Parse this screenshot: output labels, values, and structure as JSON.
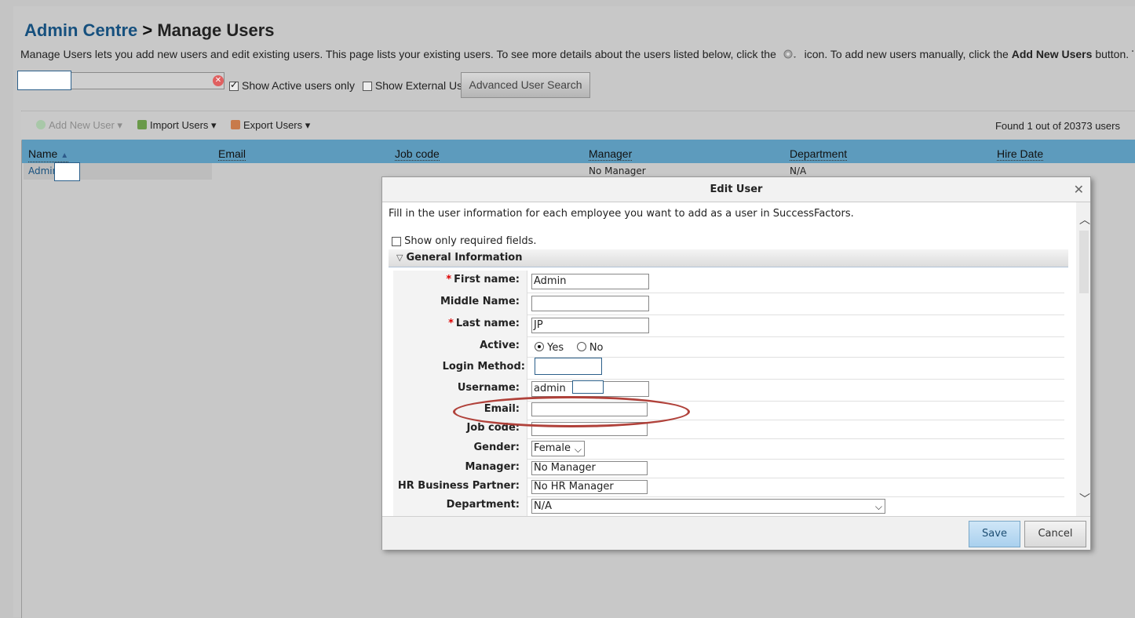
{
  "breadcrumb": {
    "parent": "Admin Centre",
    "separator": ">",
    "current": "Manage Users"
  },
  "description": {
    "before_icon": "Manage Users lets you add new users and edit existing users. This page lists your existing users. To see more details about the users listed below, click the",
    "after_icon": "icon. To add new users manually, click the",
    "bold": "Add New Users",
    "tail": "button. To import your use"
  },
  "filters": {
    "show_active_label": "Show Active users only",
    "show_active_checked": true,
    "show_external_label": "Show External User",
    "show_external_checked": false,
    "advanced_search_label": "Advanced User Search"
  },
  "toolbar": {
    "add_new_user": "Add New User",
    "import_users": "Import Users",
    "export_users": "Export Users",
    "found_text": "Found 1 out of 20373 users"
  },
  "table": {
    "columns": [
      "Name",
      "Email",
      "Job code",
      "Manager",
      "Department",
      "Hire Date"
    ],
    "rows": [
      {
        "name": "Admin",
        "email": "",
        "job_code": "",
        "manager": "No Manager",
        "department": "N/A",
        "hire_date": ""
      }
    ]
  },
  "dialog": {
    "title": "Edit User",
    "intro": "Fill in the user information for each employee you want to add as a user in SuccessFactors.",
    "required_only_label": "Show only required fields.",
    "section_title": "General Information",
    "fields": {
      "first_name": {
        "label": "First name:",
        "value": "Admin"
      },
      "middle_name": {
        "label": "Middle Name:",
        "value": ""
      },
      "last_name": {
        "label": "Last name:",
        "value": "JP"
      },
      "active": {
        "label": "Active:",
        "yes": "Yes",
        "no": "No",
        "selected": "Yes"
      },
      "login_method": {
        "label": "Login Method:",
        "value": ""
      },
      "username": {
        "label": "Username:",
        "value": "admin"
      },
      "email": {
        "label": "Email:",
        "value": ""
      },
      "job_code": {
        "label": "Job code:",
        "value": ""
      },
      "gender": {
        "label": "Gender:",
        "value": "Female"
      },
      "manager": {
        "label": "Manager:",
        "value": "No Manager"
      },
      "hr_partner": {
        "label": "HR Business Partner:",
        "value": "No HR Manager"
      },
      "department": {
        "label": "Department:",
        "value": "N/A"
      }
    },
    "save_label": "Save",
    "cancel_label": "Cancel"
  },
  "colors": {
    "header_blue": "#5d9bbd",
    "link": "#16507e",
    "highlight_ring": "#b0413a"
  }
}
